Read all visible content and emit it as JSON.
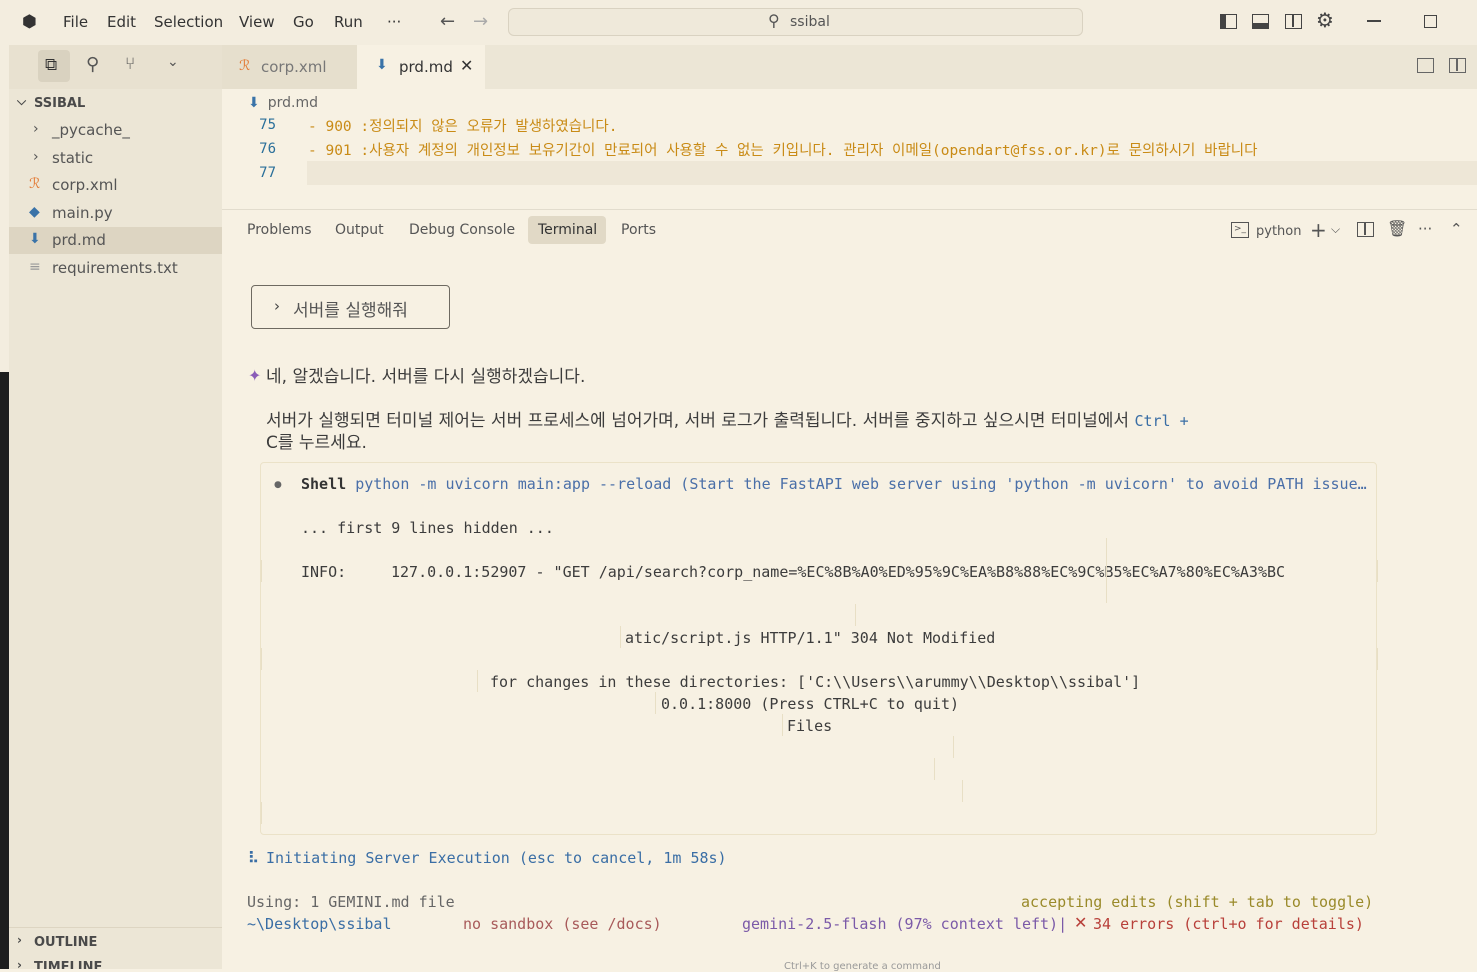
{
  "menu": [
    "File",
    "Edit",
    "Selection",
    "View",
    "Go",
    "Run",
    "···"
  ],
  "search": {
    "label": "ssibal"
  },
  "sidebar": {
    "section": "SSIBAL",
    "items": [
      {
        "label": "_pycache_",
        "icon": "chevron-right-icon"
      },
      {
        "label": "static",
        "icon": "chevron-right-icon"
      },
      {
        "label": "corp.xml",
        "icon": "rss-icon"
      },
      {
        "label": "main.py",
        "icon": "python-icon"
      },
      {
        "label": "prd.md",
        "icon": "markdown-icon"
      },
      {
        "label": "requirements.txt",
        "icon": "lines-icon"
      }
    ],
    "outline": "OUTLINE",
    "timeline": "TIMELINE"
  },
  "tabs": [
    {
      "label": "corp.xml"
    },
    {
      "label": "prd.md"
    }
  ],
  "breadcrumb": "prd.md",
  "editor": {
    "lines": [
      {
        "num": "75",
        "text": "- 900 :정의되지 않은 오류가 발생하였습니다."
      },
      {
        "num": "76",
        "text": "- 901 :사용자 계정의 개인정보 보유기간이 만료되어 사용할 수 없는 키입니다. 관리자 이메일(opendart@fss.or.kr)로 문의하시기 바랍니다"
      },
      {
        "num": "77",
        "text": ""
      }
    ]
  },
  "panel": {
    "tabs": [
      "Problems",
      "Output",
      "Debug Console",
      "Terminal",
      "Ports"
    ],
    "terminal_name": "python"
  },
  "terminal": {
    "prompt": "서버를 실행해줘",
    "reply1": "네, 알겠습니다. 서버를 다시 실행하겠습니다.",
    "reply2a": "서버가 실행되면 터미널 제어는 서버 프로세스에 넘어가며, 서버 로그가 출력됩니다. 서버를 중지하고 싶으시면 터미널에서",
    "reply2key": "Ctrl +",
    "reply2b": "C를 누르세요.",
    "shell_label": "Shell",
    "shell_cmd": "python -m uvicorn main:app --reload (Start the FastAPI web server using 'python -m uvicorn' to avoid PATH issue…",
    "hidden": "... first 9 lines hidden ...",
    "info_label": "INFO:",
    "info_text": "127.0.0.1:52907 - \"GET /api/search?corp_name=%EC%8B%A0%ED%95%9C%EA%B8%88%EC%9C%B5%EC%A7%80%EC%A3%BC",
    "frag1": "atic/script.js HTTP/1.1\" 304 Not Modified",
    "frag2": "for changes in these directories: ['C:\\\\Users\\\\arummy\\\\Desktop\\\\ssibal']",
    "frag3": "0.0.1:8000 (Press CTRL+C to quit)",
    "frag4": "Files",
    "status": "Initiating Server Execution (esc to cancel, 1m 58s)",
    "using": "Using: 1 GEMINI.md file",
    "accepting": "accepting edits (shift + tab to toggle)",
    "path": "~\\Desktop\\ssibal",
    "sandbox": "no sandbox (see /docs)",
    "model": "gemini-2.5-flash (97% context left)|",
    "errors": "34 errors (ctrl+o for details)",
    "hint": "Ctrl+K to generate a command"
  }
}
